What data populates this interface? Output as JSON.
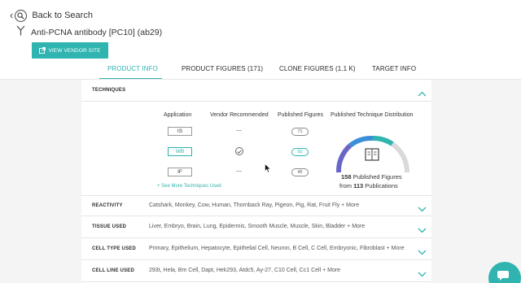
{
  "nav": {
    "back_label": "Back to Search"
  },
  "product": {
    "name": "Anti-PCNA antibody [PC10] (ab29)"
  },
  "vendor_button": {
    "label": "VIEW VENDOR SITE"
  },
  "tabs": [
    {
      "label": "PRODUCT INFO",
      "active": true
    },
    {
      "label": "PRODUCT FIGURES (171)",
      "active": false
    },
    {
      "label": "CLONE FIGURES (1.1 K)",
      "active": false
    },
    {
      "label": "TARGET INFO",
      "active": false
    }
  ],
  "techniques": {
    "title": "TECHNIQUES",
    "headers": {
      "application": "Application",
      "vendor": "Vendor Recommended",
      "published": "Published Figures",
      "distribution": "Published Technique Distribution"
    },
    "rows": [
      {
        "app": "IS",
        "vendor": "—",
        "count": "71",
        "highlight": false
      },
      {
        "app": "WB",
        "vendor": "✓",
        "count": "50",
        "highlight": true
      },
      {
        "app": "IF",
        "vendor": "—",
        "count": "45",
        "highlight": false
      }
    ],
    "more_link": "+ See More Techniques Used",
    "distribution": {
      "figures_count": "158",
      "figures_label": "Published Figures",
      "from_label": "from",
      "publications_count": "113",
      "publications_label": "Publications"
    }
  },
  "sections": [
    {
      "title": "REACTIVITY",
      "value": "Catshark, Monkey, Cow, Human, Thornback Ray, Pigeon, Pig, Rat, Fruit Fly + More"
    },
    {
      "title": "TISSUE USED",
      "value": "Liver, Embryo, Brain, Lung, Epidermis, Smooth Muscle, Muscle, Skin, Bladder + More"
    },
    {
      "title": "CELL TYPE USED",
      "value": "Primary, Epithelium, Hepatocyte, Epithelial Cell, Neuron, B Cell, C Cell, Embryonic, Fibroblast + More"
    },
    {
      "title": "CELL LINE USED",
      "value": "293t, Hela, Bm Cell, Dapt, Hek293, Atdc5, Ay-27, C10 Cell, Cc1 Cell + More"
    }
  ],
  "colors": {
    "accent": "#2fb4b0",
    "arc_purple": "#6a66c8",
    "arc_blue": "#3b8fd9"
  },
  "icons": [
    "chevron-left-icon",
    "search-icon",
    "antibody-icon",
    "external-link-icon",
    "chevron-up-icon",
    "chevron-down-icon",
    "checkmark-icon",
    "book-icon",
    "chat-icon"
  ]
}
